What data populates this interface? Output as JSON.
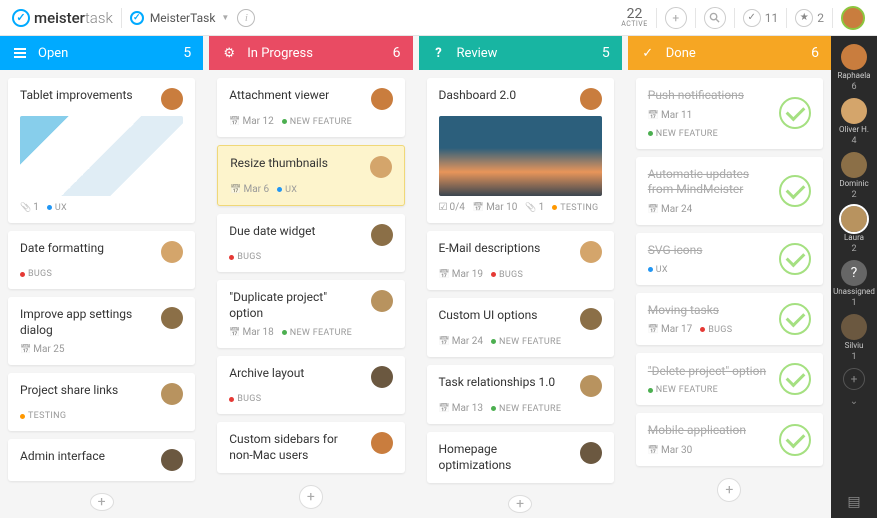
{
  "header": {
    "logo_bold": "meister",
    "logo_light": "task",
    "project_name": "MeisterTask",
    "active_number": "22",
    "active_label": "ACTIVE",
    "check_count": "11",
    "star_count": "2"
  },
  "columns": [
    {
      "key": "open",
      "title": "Open",
      "count": "5",
      "color": "col-open"
    },
    {
      "key": "progress",
      "title": "In Progress",
      "count": "6",
      "color": "col-progress"
    },
    {
      "key": "review",
      "title": "Review",
      "count": "5",
      "color": "col-review"
    },
    {
      "key": "done",
      "title": "Done",
      "count": "6",
      "color": "col-done"
    }
  ],
  "cards": {
    "open": [
      {
        "title": "Tablet improvements",
        "image": "tablets",
        "meta": [
          {
            "type": "attach",
            "text": "1"
          },
          {
            "type": "tag",
            "dot": "blue",
            "text": "UX"
          }
        ]
      },
      {
        "title": "Date formatting",
        "meta": [
          {
            "type": "tag",
            "dot": "red",
            "text": "BUGS"
          }
        ]
      },
      {
        "title": "Improve app settings dialog",
        "meta": [
          {
            "type": "cal",
            "text": "Mar 25"
          }
        ]
      },
      {
        "title": "Project share links",
        "meta": [
          {
            "type": "tag",
            "dot": "orange",
            "text": "TESTING"
          }
        ]
      },
      {
        "title": "Admin interface",
        "meta": []
      }
    ],
    "progress": [
      {
        "title": "Attachment viewer",
        "meta": [
          {
            "type": "cal",
            "text": "Mar 12"
          },
          {
            "type": "tag",
            "dot": "green",
            "text": "NEW FEATURE"
          }
        ]
      },
      {
        "title": "Resize thumbnails",
        "highlight": true,
        "meta": [
          {
            "type": "cal",
            "text": "Mar 6"
          },
          {
            "type": "tag",
            "dot": "blue",
            "text": "UX"
          }
        ]
      },
      {
        "title": "Due date widget",
        "meta": [
          {
            "type": "tag",
            "dot": "red",
            "text": "BUGS"
          }
        ]
      },
      {
        "title": "\"Duplicate project\" option",
        "meta": [
          {
            "type": "cal",
            "text": "Mar 18"
          },
          {
            "type": "tag",
            "dot": "green",
            "text": "NEW FEATURE"
          }
        ]
      },
      {
        "title": "Archive layout",
        "meta": [
          {
            "type": "tag",
            "dot": "red",
            "text": "BUGS"
          }
        ]
      },
      {
        "title": "Custom sidebars for non-Mac users",
        "meta": []
      }
    ],
    "review": [
      {
        "title": "Dashboard 2.0",
        "image": "dashboard",
        "meta": [
          {
            "type": "checklist",
            "text": "0/4"
          },
          {
            "type": "cal",
            "text": "Mar 10"
          },
          {
            "type": "attach",
            "text": "1"
          },
          {
            "type": "tag",
            "dot": "orange",
            "text": "TESTING"
          }
        ]
      },
      {
        "title": "E-Mail descriptions",
        "meta": [
          {
            "type": "cal",
            "text": "Mar 19"
          },
          {
            "type": "tag",
            "dot": "red",
            "text": "BUGS"
          }
        ]
      },
      {
        "title": "Custom UI options",
        "meta": [
          {
            "type": "cal",
            "text": "Mar 24"
          },
          {
            "type": "tag",
            "dot": "green",
            "text": "NEW FEATURE"
          }
        ]
      },
      {
        "title": "Task relationships 1.0",
        "meta": [
          {
            "type": "cal",
            "text": "Mar 13"
          },
          {
            "type": "tag",
            "dot": "green",
            "text": "NEW FEATURE"
          }
        ]
      },
      {
        "title": "Homepage optimizations",
        "meta": []
      }
    ],
    "done": [
      {
        "title": "Push notifications",
        "meta": [
          {
            "type": "cal",
            "text": "Mar 11"
          },
          {
            "type": "tag",
            "dot": "green",
            "text": "NEW FEATURE"
          }
        ]
      },
      {
        "title": "Automatic updates from MindMeister",
        "meta": [
          {
            "type": "cal",
            "text": "Mar 24"
          }
        ]
      },
      {
        "title": "SVG icons",
        "meta": [
          {
            "type": "tag",
            "dot": "blue",
            "text": "UX"
          }
        ]
      },
      {
        "title": "Moving tasks",
        "meta": [
          {
            "type": "cal",
            "text": "Mar 17"
          },
          {
            "type": "tag",
            "dot": "red",
            "text": "BUGS"
          }
        ]
      },
      {
        "title": "\"Delete project\" option",
        "meta": [
          {
            "type": "tag",
            "dot": "green",
            "text": "NEW FEATURE"
          }
        ]
      },
      {
        "title": "Mobile application",
        "meta": [
          {
            "type": "cal",
            "text": "Mar 30"
          }
        ]
      }
    ]
  },
  "sidebar_users": [
    {
      "name": "Raphaela",
      "count": "6",
      "av": "av1"
    },
    {
      "name": "Oliver H.",
      "count": "4",
      "av": "av2"
    },
    {
      "name": "Dominic",
      "count": "2",
      "av": "av3"
    },
    {
      "name": "Laura",
      "count": "2",
      "av": "av4",
      "active": true
    },
    {
      "name": "Unassigned",
      "count": "1",
      "icon": "?"
    },
    {
      "name": "Silviu",
      "count": "1",
      "av": "av5"
    }
  ]
}
